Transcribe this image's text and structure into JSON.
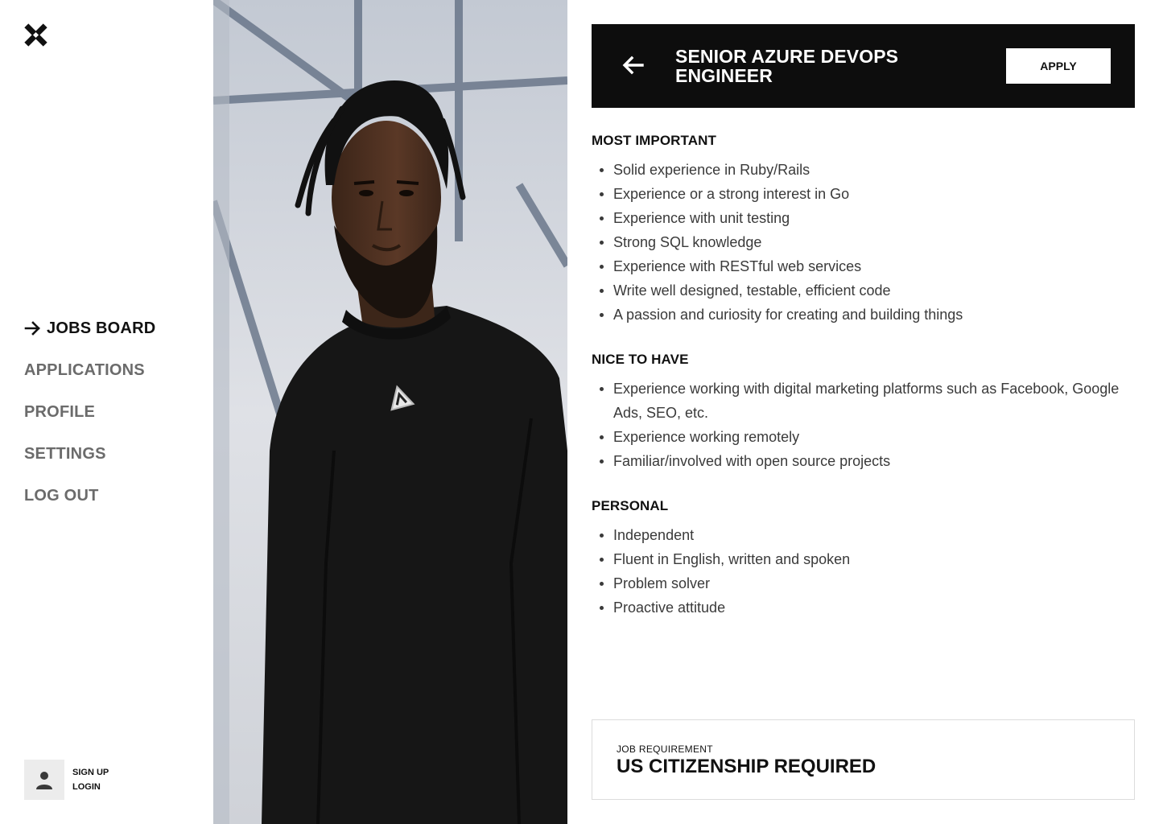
{
  "sidebar": {
    "nav": [
      {
        "label": "JOBS BOARD",
        "active": true
      },
      {
        "label": "APPLICATIONS"
      },
      {
        "label": "PROFILE"
      },
      {
        "label": "SETTINGS"
      },
      {
        "label": "LOG OUT"
      }
    ],
    "account": {
      "signup_label": "SIGN UP",
      "login_label": "LOGIN"
    }
  },
  "job": {
    "title": "SENIOR AZURE DEVOPS ENGINEER",
    "apply_label": "APPLY",
    "sections": [
      {
        "title": "MOST IMPORTANT",
        "items": [
          "Solid experience in Ruby/Rails",
          "Experience or a strong interest in Go",
          "Experience with unit testing",
          "Strong SQL knowledge",
          "Experience with RESTful web services",
          "Write well designed, testable, efficient code",
          "A passion and curiosity for creating and building things"
        ]
      },
      {
        "title": "NICE TO HAVE",
        "items": [
          "Experience working with digital marketing platforms such as Facebook, Google Ads, SEO, etc.",
          "Experience working remotely",
          "Familiar/involved with open source projects"
        ]
      },
      {
        "title": "PERSONAL",
        "items": [
          "Independent",
          "Fluent in English, written and spoken",
          "Problem solver",
          "Proactive attitude"
        ]
      }
    ],
    "requirement": {
      "label": "JOB REQUIREMENT",
      "value": "US CITIZENSHIP REQUIRED"
    }
  },
  "colors": {
    "header_bg": "#0d0d0d",
    "nav_active": "#111111",
    "nav_inactive": "#6b6b6b"
  },
  "icons": {
    "logo": "x-mark-logo-icon",
    "nav_active": "arrow-right-icon",
    "back": "arrow-left-icon",
    "avatar": "user-icon"
  }
}
